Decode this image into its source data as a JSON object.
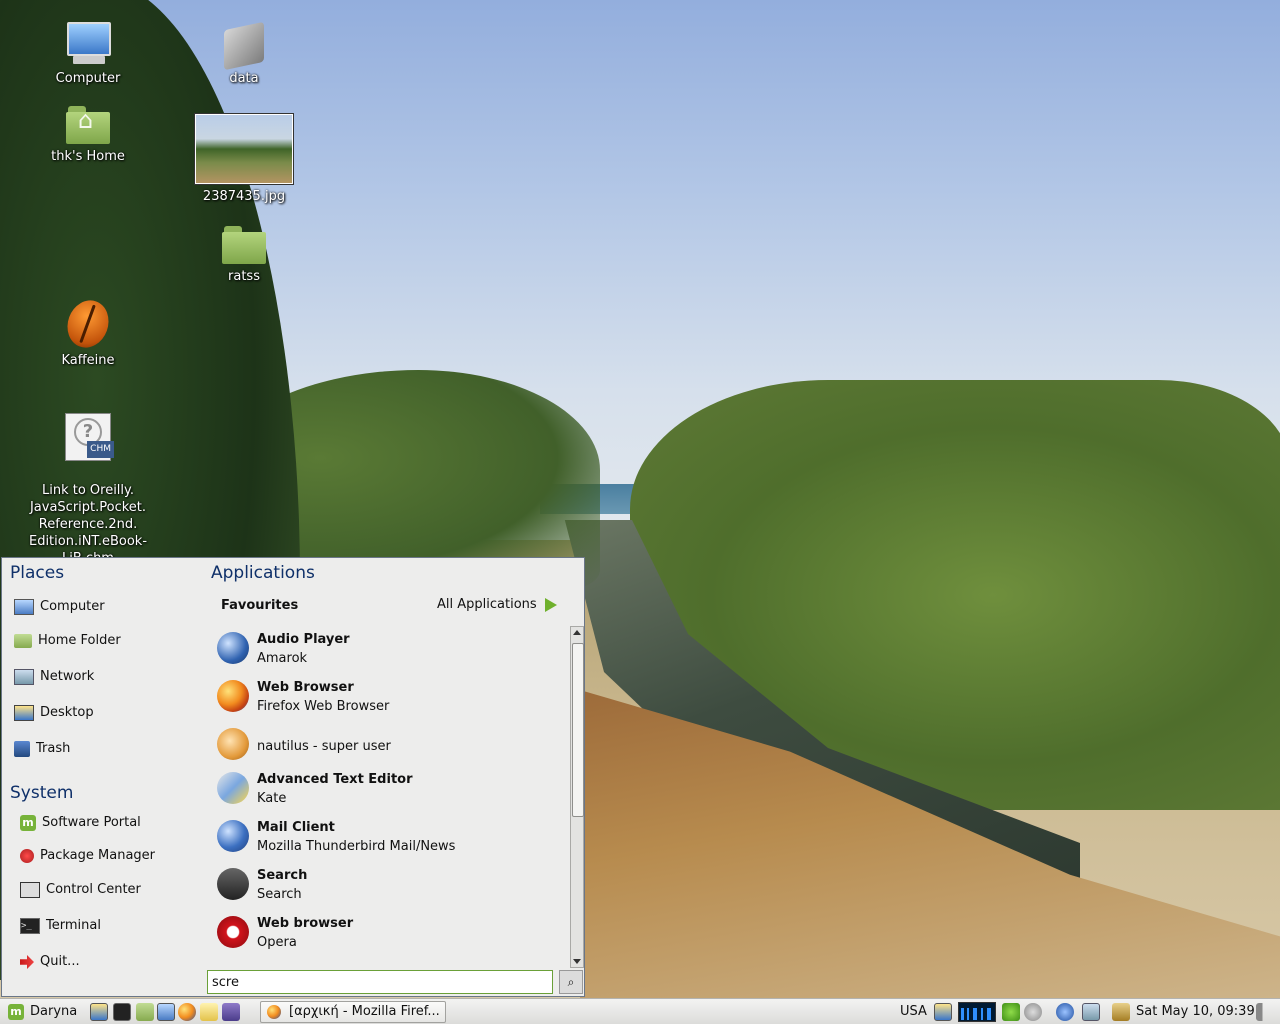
{
  "desktop": {
    "icons": [
      {
        "label": "Computer"
      },
      {
        "label": "data"
      },
      {
        "label": "thk's Home"
      },
      {
        "label": "2387435.jpg"
      },
      {
        "label": "ratss"
      },
      {
        "label": "Kaffeine"
      },
      {
        "label": "Link to Oreilly.\nJavaScript.Pocket.\nReference.2nd.\nEdition.iNT.eBook-\nLiB.chm"
      }
    ]
  },
  "menu": {
    "places": {
      "title": "Places",
      "items": [
        "Computer",
        "Home Folder",
        "Network",
        "Desktop",
        "Trash"
      ]
    },
    "system": {
      "title": "System",
      "items": [
        "Software Portal",
        "Package Manager",
        "Control Center",
        "Terminal",
        "Quit..."
      ]
    },
    "applications": {
      "title": "Applications",
      "favourites_label": "Favourites",
      "all_applications_label": "All Applications",
      "favourites": [
        {
          "name": "Audio Player",
          "comment": "Amarok",
          "icon": "amarok-icon"
        },
        {
          "name": "Web Browser",
          "comment": "Firefox Web Browser",
          "icon": "firefox-icon"
        },
        {
          "name": "",
          "comment": "nautilus - super user",
          "icon": "nautilus-icon"
        },
        {
          "name": "Advanced Text Editor",
          "comment": "Kate",
          "icon": "kate-icon"
        },
        {
          "name": "Mail Client",
          "comment": "Mozilla Thunderbird Mail/News",
          "icon": "thunderbird-icon"
        },
        {
          "name": "Search",
          "comment": "Search",
          "icon": "binoculars-icon"
        },
        {
          "name": "Web browser",
          "comment": "Opera",
          "icon": "opera-icon"
        }
      ]
    },
    "search": {
      "value": "scre"
    }
  },
  "panel": {
    "menu_button_label": "Daryna",
    "task_label": "[αρχική - Mozilla Firef...",
    "keyboard_layout": "USA",
    "clock": "Sat May 10, 09:39"
  }
}
